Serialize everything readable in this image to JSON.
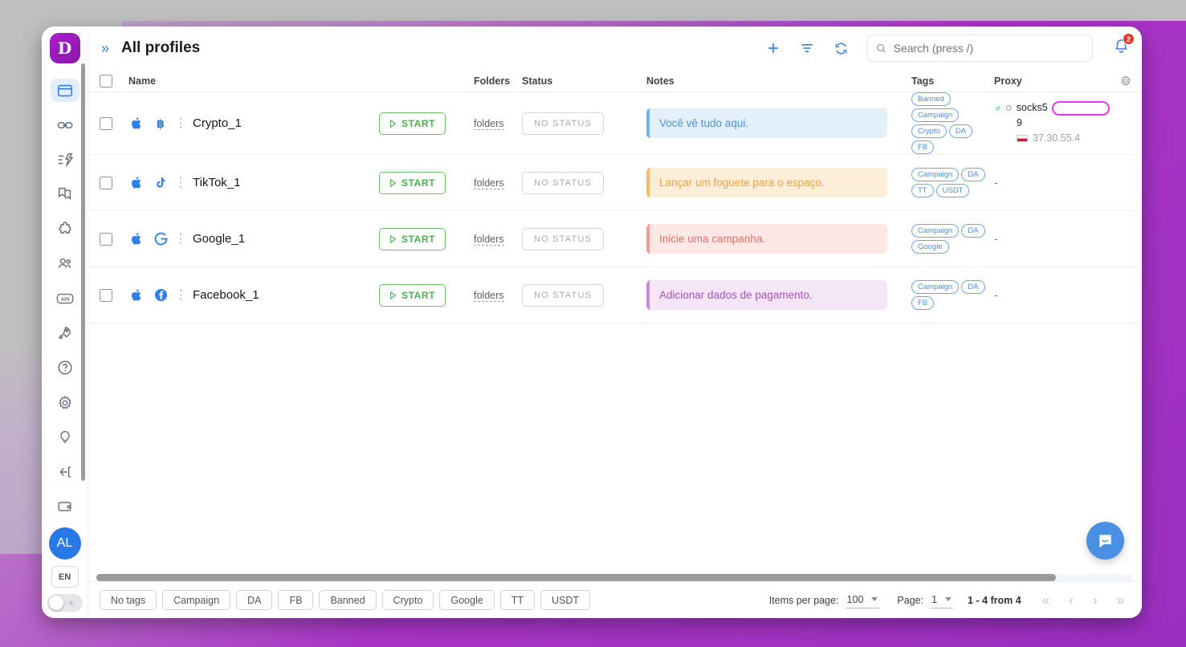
{
  "app": {
    "logo_letter": "D",
    "page_title": "All profiles",
    "collapse_icon": "chevron-double-right-icon"
  },
  "topbar": {
    "add_icon": "plus-icon",
    "filter_icon": "filter-icon",
    "refresh_icon": "refresh-icon",
    "search_placeholder": "Search (press /)",
    "search_value": "",
    "search_icon": "search-icon",
    "bell_icon": "bell-icon",
    "bell_count": "2"
  },
  "rail": {
    "items": [
      {
        "name": "browser-profiles",
        "icon": "browser-window-icon",
        "active": true
      },
      {
        "name": "proxies",
        "icon": "link-icon",
        "active": false
      },
      {
        "name": "automation",
        "icon": "lightning-list-icon",
        "active": false
      },
      {
        "name": "cookies",
        "icon": "copy-pages-icon",
        "active": false
      },
      {
        "name": "extensions",
        "icon": "puzzle-icon",
        "active": false
      },
      {
        "name": "team",
        "icon": "users-icon",
        "active": false
      },
      {
        "name": "api",
        "icon": "api-icon",
        "active": false
      },
      {
        "name": "quick-start",
        "icon": "rocket-icon",
        "active": false
      },
      {
        "name": "help",
        "icon": "question-circle-icon",
        "active": false
      },
      {
        "name": "settings",
        "icon": "gear-icon",
        "active": false
      },
      {
        "name": "tips",
        "icon": "bulb-icon",
        "active": false
      },
      {
        "name": "logout",
        "icon": "exit-arrow-icon",
        "active": false
      },
      {
        "name": "billing",
        "icon": "wallet-icon",
        "active": false
      }
    ],
    "avatar_initials": "AL",
    "language": "EN",
    "theme_icon": "sun-icon"
  },
  "table": {
    "columns": [
      "Name",
      "Folders",
      "Status",
      "Notes",
      "Tags",
      "Proxy"
    ],
    "settings_icon": "gear-icon",
    "header_checkbox": "select-all",
    "rows": [
      {
        "name": "Crypto_1",
        "os_icon": "apple-icon",
        "app_icon": "bitcoin-icon",
        "start_label": "START",
        "folders_label": "folders",
        "status_label": "NO STATUS",
        "note": "Você vê tudo aqui.",
        "note_bg": "#e3f0fb",
        "note_border": "#74b3e8",
        "note_color": "#4a93d8",
        "tags": [
          "Banned",
          "Campaign",
          "Crypto",
          "DA",
          "FB"
        ],
        "proxy_type": "socks5",
        "proxy_extra": "9",
        "proxy_ip": "37.30.55.4",
        "proxy_flag": "pl",
        "proxy_highlighted": true
      },
      {
        "name": "TikTok_1",
        "os_icon": "apple-icon",
        "app_icon": "tiktok-icon",
        "start_label": "START",
        "folders_label": "folders",
        "status_label": "NO STATUS",
        "note": "Lançar um foguete para o espaço.",
        "note_bg": "#fdeed8",
        "note_border": "#f5bb66",
        "note_color": "#f0a23d",
        "tags": [
          "Campaign",
          "DA",
          "TT",
          "USDT"
        ],
        "proxy_dash": "-"
      },
      {
        "name": "Google_1",
        "os_icon": "apple-icon",
        "app_icon": "google-icon",
        "start_label": "START",
        "folders_label": "folders",
        "status_label": "NO STATUS",
        "note": "Inicie uma campanha.",
        "note_bg": "#fde8e6",
        "note_border": "#f09b93",
        "note_color": "#ea6e63",
        "tags": [
          "Campaign",
          "DA",
          "Google"
        ],
        "proxy_dash": "-"
      },
      {
        "name": "Facebook_1",
        "os_icon": "apple-icon",
        "app_icon": "facebook-icon",
        "start_label": "START",
        "folders_label": "folders",
        "status_label": "NO STATUS",
        "note": "Adicionar dados de pagamento.",
        "note_bg": "#f4e6f7",
        "note_border": "#c88cd8",
        "note_color": "#a453c1",
        "tags": [
          "Campaign",
          "DA",
          "FB"
        ],
        "proxy_dash": "-"
      }
    ]
  },
  "footer": {
    "tag_filters": [
      "No tags",
      "Campaign",
      "DA",
      "FB",
      "Banned",
      "Crypto",
      "Google",
      "TT",
      "USDT"
    ],
    "items_per_page_label": "Items per page:",
    "items_per_page_value": "100",
    "page_label": "Page:",
    "page_value": "1",
    "range_text": "1 - 4 from 4",
    "nav": [
      "«",
      "‹",
      "›",
      "»"
    ]
  },
  "chat": {
    "icon": "chat-bubble-icon"
  }
}
